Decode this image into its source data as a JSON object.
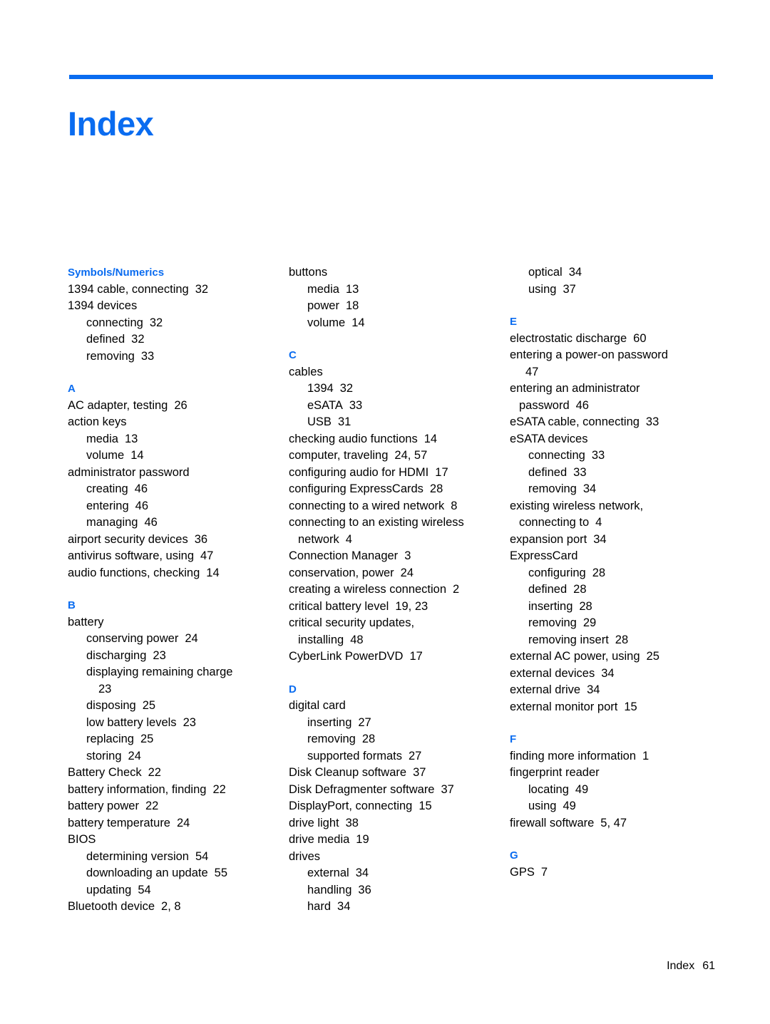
{
  "document": {
    "title": "Index",
    "accent_color": "#0a6cf0",
    "footer": {
      "label": "Index",
      "page_number": "61"
    }
  },
  "columns": [
    {
      "sections": [
        {
          "letter": "Symbols/Numerics",
          "entries": [
            {
              "level": 1,
              "text": "1394 cable, connecting",
              "page": "32"
            },
            {
              "level": 1,
              "text": "1394 devices",
              "page": ""
            },
            {
              "level": 2,
              "text": "connecting",
              "page": "32"
            },
            {
              "level": 2,
              "text": "defined",
              "page": "32"
            },
            {
              "level": 2,
              "text": "removing",
              "page": "33"
            }
          ]
        },
        {
          "letter": "A",
          "entries": [
            {
              "level": 1,
              "text": "AC adapter, testing",
              "page": "26"
            },
            {
              "level": 1,
              "text": "action keys",
              "page": ""
            },
            {
              "level": 2,
              "text": "media",
              "page": "13"
            },
            {
              "level": 2,
              "text": "volume",
              "page": "14"
            },
            {
              "level": 1,
              "text": "administrator password",
              "page": ""
            },
            {
              "level": 2,
              "text": "creating",
              "page": "46"
            },
            {
              "level": 2,
              "text": "entering",
              "page": "46"
            },
            {
              "level": 2,
              "text": "managing",
              "page": "46"
            },
            {
              "level": 1,
              "text": "airport security devices",
              "page": "36"
            },
            {
              "level": 1,
              "text": "antivirus software, using",
              "page": "47"
            },
            {
              "level": 1,
              "text": "audio functions, checking",
              "page": "14"
            }
          ]
        },
        {
          "letter": "B",
          "entries": [
            {
              "level": 1,
              "text": "battery",
              "page": ""
            },
            {
              "level": 2,
              "text": "conserving power",
              "page": "24"
            },
            {
              "level": 2,
              "text": "discharging",
              "page": "23"
            },
            {
              "level": 2,
              "text": "displaying remaining charge",
              "page": ""
            },
            {
              "level": "cont2",
              "text": "",
              "page": "23"
            },
            {
              "level": 2,
              "text": "disposing",
              "page": "25"
            },
            {
              "level": 2,
              "text": "low battery levels",
              "page": "23"
            },
            {
              "level": 2,
              "text": "replacing",
              "page": "25"
            },
            {
              "level": 2,
              "text": "storing",
              "page": "24"
            },
            {
              "level": 1,
              "text": "Battery Check",
              "page": "22"
            },
            {
              "level": 1,
              "text": "battery information, finding",
              "page": "22"
            },
            {
              "level": 1,
              "text": "battery power",
              "page": "22"
            },
            {
              "level": 1,
              "text": "battery temperature",
              "page": "24"
            },
            {
              "level": 1,
              "text": "BIOS",
              "page": ""
            },
            {
              "level": 2,
              "text": "determining version",
              "page": "54"
            },
            {
              "level": 2,
              "text": "downloading an update",
              "page": "55"
            },
            {
              "level": 2,
              "text": "updating",
              "page": "54"
            },
            {
              "level": 1,
              "text": "Bluetooth device",
              "page": "2, 8"
            }
          ]
        }
      ]
    },
    {
      "sections": [
        {
          "letter": "",
          "entries": [
            {
              "level": 1,
              "text": "buttons",
              "page": ""
            },
            {
              "level": 2,
              "text": "media",
              "page": "13"
            },
            {
              "level": 2,
              "text": "power",
              "page": "18"
            },
            {
              "level": 2,
              "text": "volume",
              "page": "14"
            }
          ]
        },
        {
          "letter": "C",
          "entries": [
            {
              "level": 1,
              "text": "cables",
              "page": ""
            },
            {
              "level": 2,
              "text": "1394",
              "page": "32"
            },
            {
              "level": 2,
              "text": "eSATA",
              "page": "33"
            },
            {
              "level": 2,
              "text": "USB",
              "page": "31"
            },
            {
              "level": 1,
              "text": "checking audio functions",
              "page": "14"
            },
            {
              "level": 1,
              "text": "computer, traveling",
              "page": "24, 57"
            },
            {
              "level": 1,
              "text": "configuring audio for HDMI",
              "page": "17"
            },
            {
              "level": 1,
              "text": "configuring ExpressCards",
              "page": "28"
            },
            {
              "level": 1,
              "text": "connecting to a wired network",
              "page": "8"
            },
            {
              "level": 1,
              "text": "connecting to an existing wireless",
              "page": ""
            },
            {
              "level": "cont1",
              "text": "network",
              "page": "4"
            },
            {
              "level": 1,
              "text": "Connection Manager",
              "page": "3"
            },
            {
              "level": 1,
              "text": "conservation, power",
              "page": "24"
            },
            {
              "level": 1,
              "text": "creating a wireless connection",
              "page": "2"
            },
            {
              "level": 1,
              "text": "critical battery level",
              "page": "19, 23"
            },
            {
              "level": 1,
              "text": "critical security updates,",
              "page": ""
            },
            {
              "level": "cont1",
              "text": "installing",
              "page": "48"
            },
            {
              "level": 1,
              "text": "CyberLink PowerDVD",
              "page": "17"
            }
          ]
        },
        {
          "letter": "D",
          "entries": [
            {
              "level": 1,
              "text": "digital card",
              "page": ""
            },
            {
              "level": 2,
              "text": "inserting",
              "page": "27"
            },
            {
              "level": 2,
              "text": "removing",
              "page": "28"
            },
            {
              "level": 2,
              "text": "supported formats",
              "page": "27"
            },
            {
              "level": 1,
              "text": "Disk Cleanup software",
              "page": "37"
            },
            {
              "level": 1,
              "text": "Disk Defragmenter software",
              "page": "37"
            },
            {
              "level": 1,
              "text": "DisplayPort, connecting",
              "page": "15"
            },
            {
              "level": 1,
              "text": "drive light",
              "page": "38"
            },
            {
              "level": 1,
              "text": "drive media",
              "page": "19"
            },
            {
              "level": 1,
              "text": "drives",
              "page": ""
            },
            {
              "level": 2,
              "text": "external",
              "page": "34"
            },
            {
              "level": 2,
              "text": "handling",
              "page": "36"
            },
            {
              "level": 2,
              "text": "hard",
              "page": "34"
            }
          ]
        }
      ]
    },
    {
      "sections": [
        {
          "letter": "",
          "entries": [
            {
              "level": 2,
              "text": "optical",
              "page": "34"
            },
            {
              "level": 2,
              "text": "using",
              "page": "37"
            }
          ]
        },
        {
          "letter": "E",
          "entries": [
            {
              "level": 1,
              "text": "electrostatic discharge",
              "page": "60"
            },
            {
              "level": 1,
              "text": "entering a power-on password",
              "page": ""
            },
            {
              "level": "cont1",
              "text": "",
              "page": "47"
            },
            {
              "level": 1,
              "text": "entering an administrator",
              "page": ""
            },
            {
              "level": "cont1",
              "text": "password",
              "page": "46"
            },
            {
              "level": 1,
              "text": "eSATA cable, connecting",
              "page": "33"
            },
            {
              "level": 1,
              "text": "eSATA devices",
              "page": ""
            },
            {
              "level": 2,
              "text": "connecting",
              "page": "33"
            },
            {
              "level": 2,
              "text": "defined",
              "page": "33"
            },
            {
              "level": 2,
              "text": "removing",
              "page": "34"
            },
            {
              "level": 1,
              "text": "existing wireless network,",
              "page": ""
            },
            {
              "level": "cont1",
              "text": "connecting to",
              "page": "4"
            },
            {
              "level": 1,
              "text": "expansion port",
              "page": "34"
            },
            {
              "level": 1,
              "text": "ExpressCard",
              "page": ""
            },
            {
              "level": 2,
              "text": "configuring",
              "page": "28"
            },
            {
              "level": 2,
              "text": "defined",
              "page": "28"
            },
            {
              "level": 2,
              "text": "inserting",
              "page": "28"
            },
            {
              "level": 2,
              "text": "removing",
              "page": "29"
            },
            {
              "level": 2,
              "text": "removing insert",
              "page": "28"
            },
            {
              "level": 1,
              "text": "external AC power, using",
              "page": "25"
            },
            {
              "level": 1,
              "text": "external devices",
              "page": "34"
            },
            {
              "level": 1,
              "text": "external drive",
              "page": "34"
            },
            {
              "level": 1,
              "text": "external monitor port",
              "page": "15"
            }
          ]
        },
        {
          "letter": "F",
          "entries": [
            {
              "level": 1,
              "text": "finding more information",
              "page": "1"
            },
            {
              "level": 1,
              "text": "fingerprint reader",
              "page": ""
            },
            {
              "level": 2,
              "text": "locating",
              "page": "49"
            },
            {
              "level": 2,
              "text": "using",
              "page": "49"
            },
            {
              "level": 1,
              "text": "firewall software",
              "page": "5, 47"
            }
          ]
        },
        {
          "letter": "G",
          "entries": [
            {
              "level": 1,
              "text": "GPS",
              "page": "7"
            }
          ]
        }
      ]
    }
  ]
}
